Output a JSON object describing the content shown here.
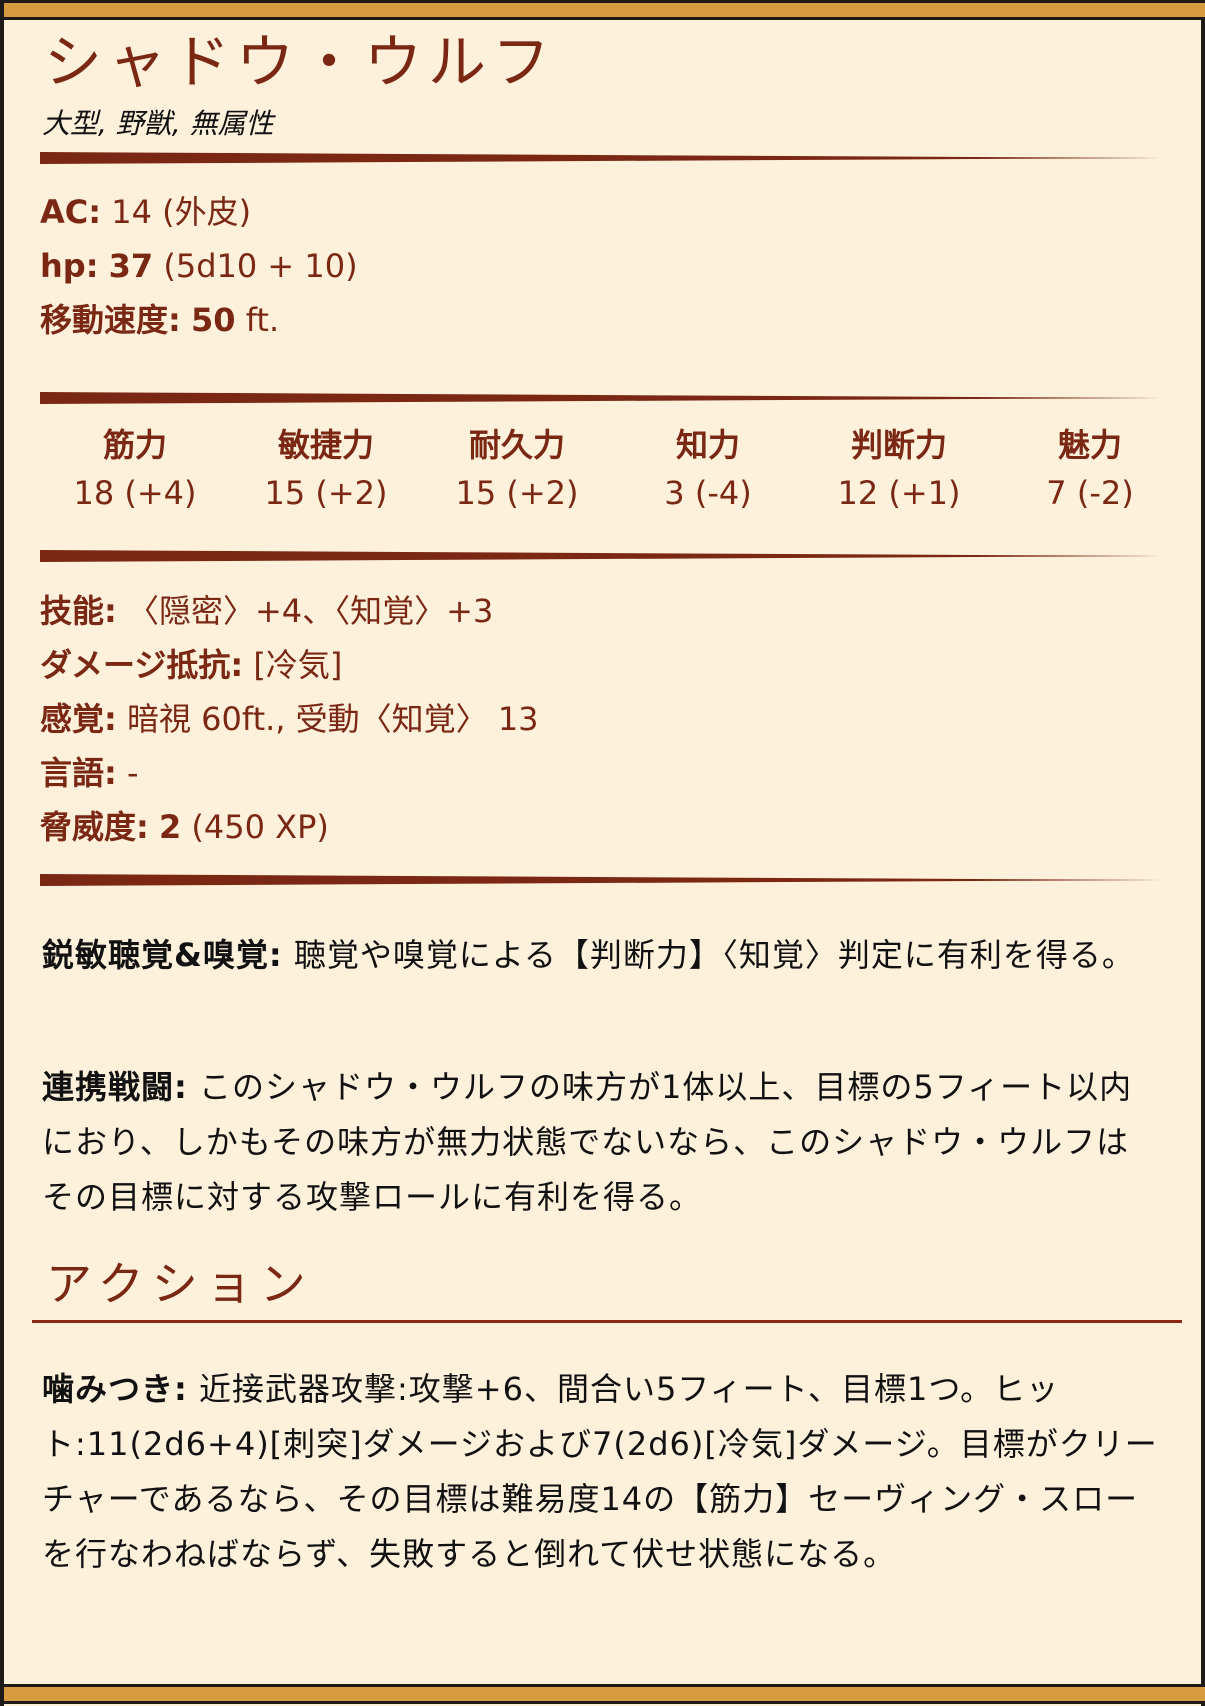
{
  "monster": {
    "name": "シャドウ・ウルフ",
    "meta": "大型, 野獣, 無属性"
  },
  "basics": {
    "ac_label": "AC:",
    "ac_value": "14 (外皮)",
    "hp_label": "hp:",
    "hp_value": "37",
    "hp_formula": "(5d10 + 10)",
    "speed_label": "移動速度:",
    "speed_value": "50",
    "speed_unit": "ft."
  },
  "abilities": [
    {
      "name": "筋力",
      "score": "18 (+4)"
    },
    {
      "name": "敏捷力",
      "score": "15 (+2)"
    },
    {
      "name": "耐久力",
      "score": "15 (+2)"
    },
    {
      "name": "知力",
      "score": "3 (-4)"
    },
    {
      "name": "判断力",
      "score": "12 (+1)"
    },
    {
      "name": "魅力",
      "score": "7 (-2)"
    }
  ],
  "properties": {
    "skills_label": "技能:",
    "skills_value": "〈隠密〉+4、〈知覚〉+3",
    "resist_label": "ダメージ抵抗:",
    "resist_value": "[冷気]",
    "senses_label": "感覚:",
    "senses_value": "暗視 60ft., 受動〈知覚〉 13",
    "languages_label": "言語:",
    "languages_value": "-",
    "cr_label": "脅威度:",
    "cr_value": "2",
    "cr_xp": "(450 XP)"
  },
  "traits": [
    {
      "name": "鋭敏聴覚&嗅覚:",
      "text": "聴覚や嗅覚による【判断力】〈知覚〉判定に有利を得る。"
    },
    {
      "name": "連携戦闘:",
      "text": "このシャドウ・ウルフの味方が1体以上、目標の5フィート以内におり、しかもその味方が無力状態でないなら、このシャドウ・ウルフはその目標に対する攻撃ロールに有利を得る。"
    }
  ],
  "actions_title": "アクション",
  "actions": [
    {
      "name": "噛みつき:",
      "text": "近接武器攻撃:攻撃+6、間合い5フィート、目標1つ。ヒット:11(2d6+4)[刺突]ダメージおよび7(2d6)[冷気]ダメージ。目標がクリーチャーであるなら、その目標は難易度14の【筋力】セーヴィング・スローを行なわねばならず、失敗すると倒れて伏せ状態になる。"
    }
  ],
  "colors": {
    "background": "#fdf1dc",
    "accent": "#7a2714",
    "band": "#d79c3f"
  }
}
